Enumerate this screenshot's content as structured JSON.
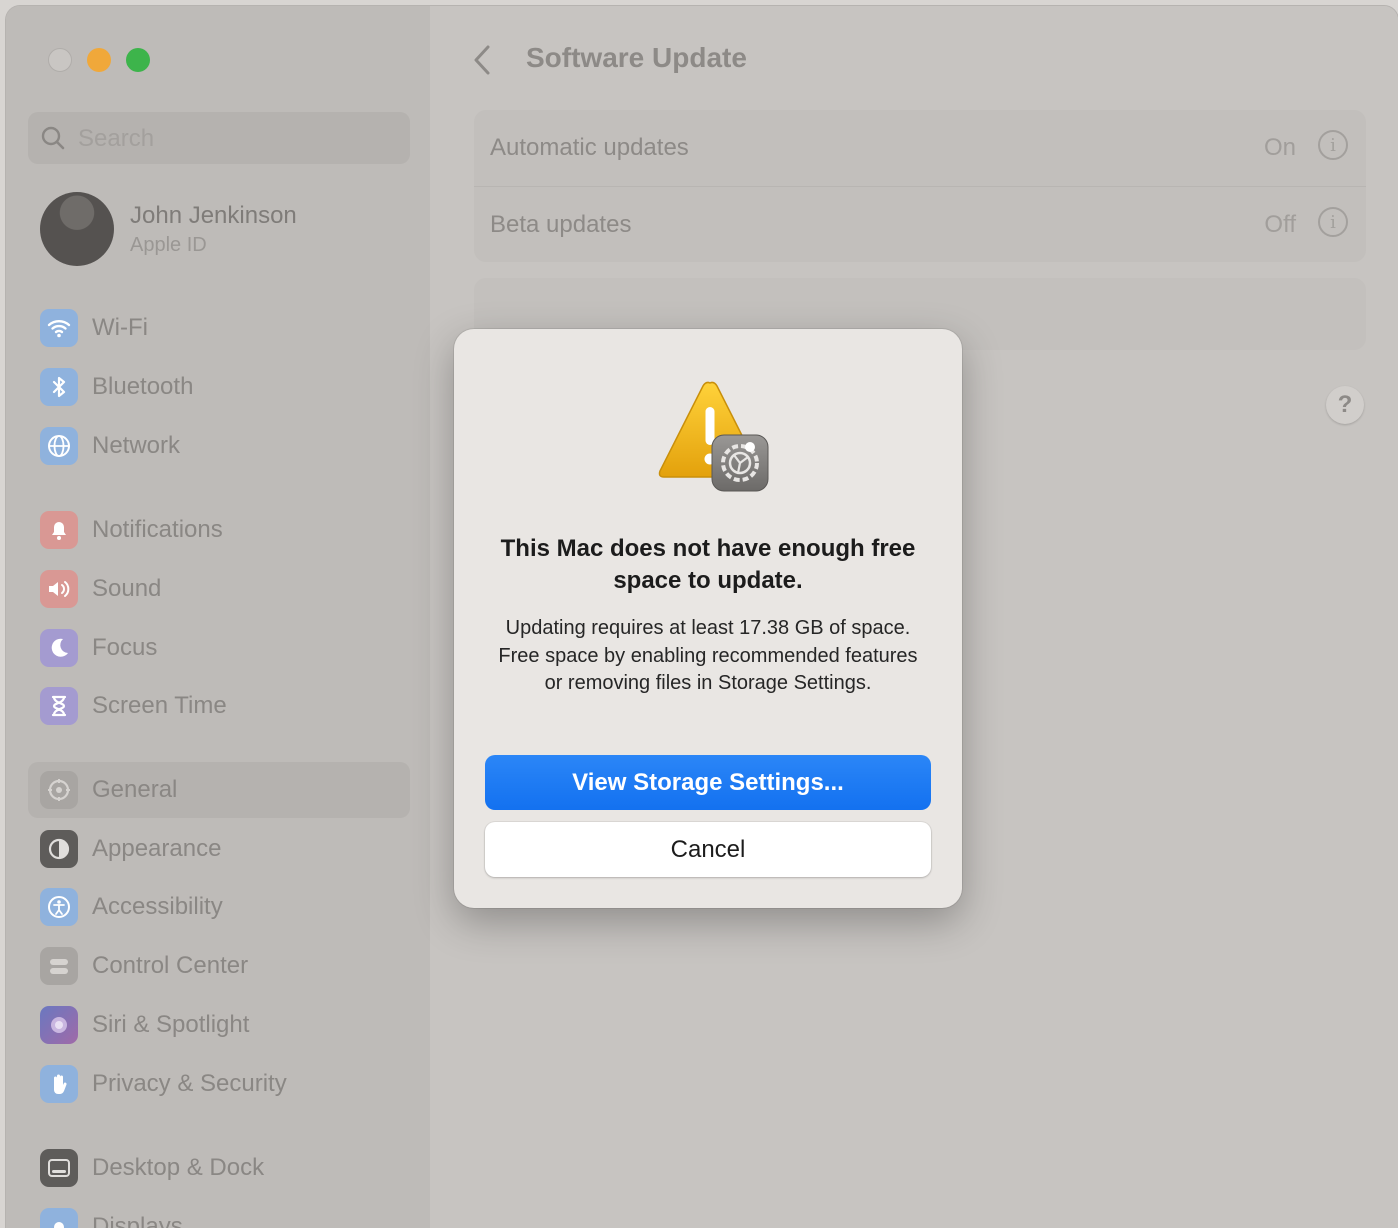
{
  "sidebar": {
    "search_placeholder": "Search",
    "profile": {
      "name": "John Jenkinson",
      "subtitle": "Apple ID"
    },
    "items": [
      {
        "label": "Wi-Fi",
        "icon": "wifi-icon",
        "color": "#3d8ef0"
      },
      {
        "label": "Bluetooth",
        "icon": "bluetooth-icon",
        "color": "#3d8ef0"
      },
      {
        "label": "Network",
        "icon": "globe-icon",
        "color": "#3d8ef0"
      },
      {
        "label": "Notifications",
        "icon": "bell-icon",
        "color": "#e8504a"
      },
      {
        "label": "Sound",
        "icon": "speaker-icon",
        "color": "#e8504a"
      },
      {
        "label": "Focus",
        "icon": "moon-icon",
        "color": "#6a55d6"
      },
      {
        "label": "Screen Time",
        "icon": "hourglass-icon",
        "color": "#6a55d6"
      },
      {
        "label": "General",
        "icon": "gear-icon",
        "color": "#9a9794",
        "selected": true
      },
      {
        "label": "Appearance",
        "icon": "appearance-icon",
        "color": "#2a2a2a"
      },
      {
        "label": "Accessibility",
        "icon": "accessibility-icon",
        "color": "#3d8ef0"
      },
      {
        "label": "Control Center",
        "icon": "control-center-icon",
        "color": "#9a9794"
      },
      {
        "label": "Siri & Spotlight",
        "icon": "siri-icon",
        "color": "#7a4fd0"
      },
      {
        "label": "Privacy & Security",
        "icon": "hand-icon",
        "color": "#3d8ef0"
      },
      {
        "label": "Desktop & Dock",
        "icon": "dock-icon",
        "color": "#2a2a2a"
      },
      {
        "label": "Displays",
        "icon": "display-icon",
        "color": "#3d8ef0"
      }
    ]
  },
  "main": {
    "title": "Software Update",
    "rows": [
      {
        "label": "Automatic updates",
        "value": "On"
      },
      {
        "label": "Beta updates",
        "value": "Off"
      }
    ],
    "help_label": "?"
  },
  "dialog": {
    "title": "This Mac does not have enough free space to update.",
    "body": "Updating requires at least 17.38 GB of space. Free space by enabling recommended features or removing files in Storage Settings.",
    "primary_button": "View Storage Settings...",
    "secondary_button": "Cancel",
    "accent_color": "#1a76f2"
  }
}
